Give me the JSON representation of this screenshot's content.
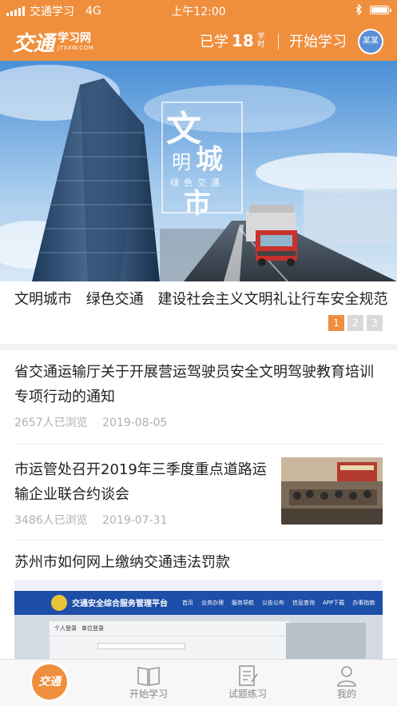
{
  "status_bar": {
    "carrier": "交通学习",
    "network": "4G",
    "time": "上午12:00"
  },
  "header": {
    "logo_mark": "交通",
    "logo_name": "学习网",
    "logo_domain": "JTXXW.COM",
    "learned_prefix": "已学",
    "learned_count": "18",
    "learned_unit": "学时",
    "start_label": "开始学习",
    "user_name": "某某"
  },
  "banner": {
    "slogan_main": "文明城市",
    "slogan_sub": "绿色交通",
    "caption": "文明城市 绿色交通 建设社会主义文明礼让行车安全规范",
    "pages": [
      "1",
      "2",
      "3"
    ],
    "active_page": 0
  },
  "news": [
    {
      "title": "省交通运输厅关于开展营运驾驶员安全文明驾驶教育培训专项行动的通知",
      "views": "2657人已浏览",
      "date": "2019-08-05"
    },
    {
      "title": "市运管处召开2019年三季度重点道路运输企业联合约谈会",
      "views": "3486人已浏览",
      "date": "2019-07-31"
    },
    {
      "title": "苏州市如何网上缴纳交通违法罚款",
      "preview": {
        "site_title": "交通安全综合服务管理平台",
        "nav": [
          "首页",
          "业务办理",
          "服务导航",
          "公告公布",
          "信息查询",
          "APP下载",
          "办事指南"
        ],
        "tabs": [
          "个人登录",
          "单位登录"
        ]
      }
    }
  ],
  "tabbar": {
    "home_label": "交通",
    "items": [
      "开始学习",
      "试题练习",
      "我的"
    ]
  },
  "colors": {
    "accent": "#ef8f3d",
    "text": "#222222",
    "meta": "#b0b0b0"
  }
}
